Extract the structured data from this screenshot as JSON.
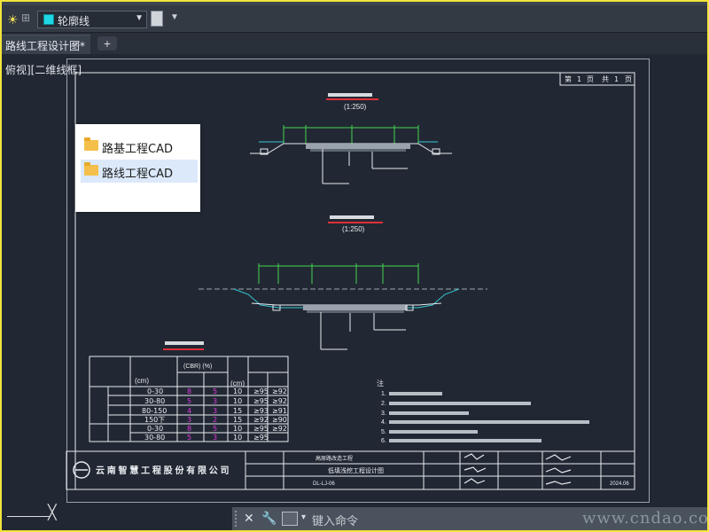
{
  "toolbar": {
    "layer_name": "轮廓线",
    "layer_color": "#20d7e6",
    "icons": [
      "sun-icon",
      "layer-state-icon",
      "chevron-down-icon",
      "layer-button-icon"
    ]
  },
  "tabs": {
    "document": "路线工程设计图*",
    "close": "×",
    "new": "+"
  },
  "viewport": {
    "label": "俯视][二维线框]"
  },
  "popup": {
    "items": [
      {
        "label": "路基工程CAD",
        "icon": "folder-icon"
      },
      {
        "label": "路线工程CAD",
        "icon": "folder-icon",
        "selected": true
      }
    ]
  },
  "drawing": {
    "page_indicator": [
      "第",
      "1",
      "页",
      "共",
      "1",
      "页"
    ],
    "section1_scale": "(1:250)",
    "section2_scale": "(1:250)",
    "table_rows": [
      [
        "0-30",
        "8",
        "5",
        "10",
        "≥95",
        "≥92"
      ],
      [
        "30-80",
        "5",
        "3",
        "10",
        "≥95",
        "≥92"
      ],
      [
        "80-150",
        "4",
        "3",
        "15",
        "≥93",
        "≥91"
      ],
      [
        "150下",
        "3",
        "2",
        "15",
        "≥92",
        "≥90"
      ],
      [
        "0-30",
        "8",
        "5",
        "10",
        "≥95",
        "≥92"
      ],
      [
        "30-80",
        "5",
        "3",
        "10",
        "≥95",
        ""
      ]
    ],
    "table_header_units": "(cm)",
    "table_header_cbr": "(CBR) (%)",
    "notes_title": "注",
    "notes_numbers": [
      "1.",
      "2.",
      "3.",
      "4.",
      "5.",
      "6."
    ],
    "company": "云 南 智 慧 工 程 股 份 有 限 公 司",
    "drawing_title": "低填浅挖工程设计图",
    "drawing_no": "DL-LJ-06",
    "date": "2024.06",
    "project_name": "高原路改造工程"
  },
  "cmdline": {
    "placeholder": "键入命令",
    "icons": [
      "close-icon",
      "wrench-icon",
      "command-prompt-icon"
    ]
  },
  "watermark": "www.cndao.com"
}
